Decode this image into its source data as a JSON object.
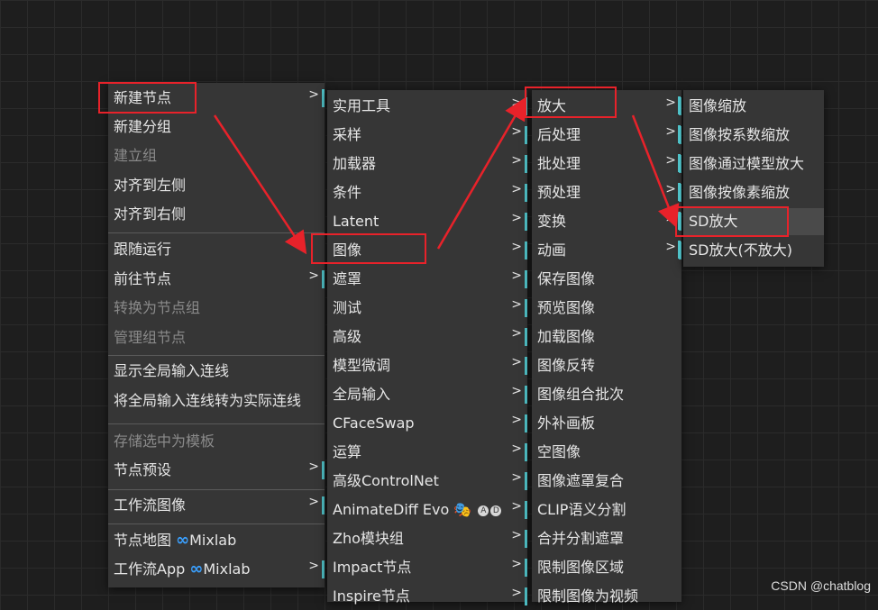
{
  "menu1": {
    "items": [
      {
        "label": "新建节点",
        "submenu": true
      },
      {
        "label": "新建分组"
      },
      {
        "label": "建立组",
        "disabled": true
      },
      {
        "label": "对齐到左侧"
      },
      {
        "label": "对齐到右侧"
      },
      {
        "label": "跟随运行"
      },
      {
        "label": "前往节点",
        "submenu": true
      },
      {
        "label": "转换为节点组",
        "disabled": true
      },
      {
        "label": "管理组节点",
        "disabled": true
      },
      {
        "label": "显示全局输入连线"
      },
      {
        "label": "将全局输入连线转为实际连线"
      },
      {
        "label": "存储选中为模板",
        "disabled": true
      },
      {
        "label": "节点预设",
        "submenu": true
      },
      {
        "label": "工作流图像",
        "submenu": true
      },
      {
        "label": "节点地图",
        "brand": "Mixlab"
      },
      {
        "label": "工作流App",
        "brand": "Mixlab",
        "submenu": true
      }
    ]
  },
  "menu2": {
    "items": [
      {
        "label": "实用工具"
      },
      {
        "label": "采样"
      },
      {
        "label": "加载器"
      },
      {
        "label": "条件"
      },
      {
        "label": "Latent"
      },
      {
        "label": "图像"
      },
      {
        "label": "遮罩"
      },
      {
        "label": "测试"
      },
      {
        "label": "高级"
      },
      {
        "label": "模型微调"
      },
      {
        "label": "全局输入"
      },
      {
        "label": "CFaceSwap"
      },
      {
        "label": "运算"
      },
      {
        "label": "高级ControlNet"
      },
      {
        "label": "AnimateDiff Evo"
      },
      {
        "label": "Zho模块组"
      },
      {
        "label": "Impact节点"
      },
      {
        "label": "Inspire节点"
      }
    ]
  },
  "menu3": {
    "items": [
      {
        "label": "放大",
        "submenu": true
      },
      {
        "label": "后处理",
        "submenu": true
      },
      {
        "label": "批处理",
        "submenu": true
      },
      {
        "label": "预处理",
        "submenu": true
      },
      {
        "label": "变换",
        "submenu": true
      },
      {
        "label": "动画",
        "submenu": true
      },
      {
        "label": "保存图像"
      },
      {
        "label": "预览图像"
      },
      {
        "label": "加载图像"
      },
      {
        "label": "图像反转"
      },
      {
        "label": "图像组合批次"
      },
      {
        "label": "外补画板"
      },
      {
        "label": "空图像"
      },
      {
        "label": "图像遮罩复合"
      },
      {
        "label": "CLIP语义分割"
      },
      {
        "label": "合并分割遮罩"
      },
      {
        "label": "限制图像区域"
      },
      {
        "label": "限制图像为视频"
      }
    ]
  },
  "menu4": {
    "items": [
      {
        "label": "图像缩放"
      },
      {
        "label": "图像按系数缩放"
      },
      {
        "label": "图像通过模型放大"
      },
      {
        "label": "图像按像素缩放"
      },
      {
        "label": "SD放大"
      },
      {
        "label": "SD放大(不放大)"
      }
    ]
  },
  "chevron": ">",
  "animatediff_badges": [
    "A",
    "D"
  ],
  "watermark": "CSDN @chatblog",
  "colors": {
    "accent_bar": "#4fc1c7",
    "highlight_box": "#e8222a",
    "arrow": "#e8222a",
    "mixlab": "#3aa0ff"
  }
}
